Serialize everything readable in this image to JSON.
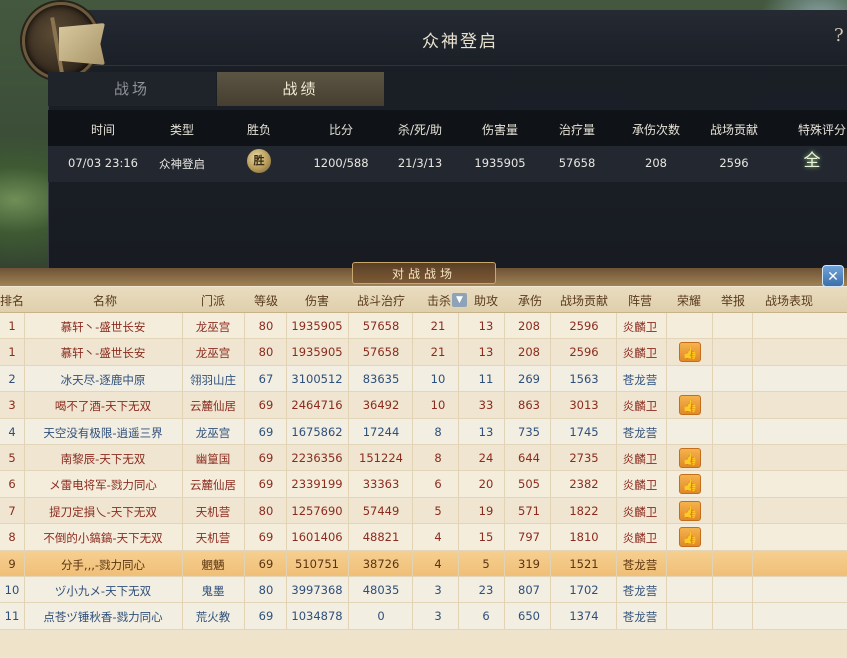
{
  "window": {
    "title": "众神登启",
    "help_symbol": "?"
  },
  "tabs": [
    {
      "label": "战场",
      "active": false
    },
    {
      "label": "战绩",
      "active": true
    }
  ],
  "record": {
    "headers": [
      "时间",
      "类型",
      "胜负",
      "比分",
      "杀/死/助",
      "伤害量",
      "治疗量",
      "承伤次数",
      "战场贡献",
      "特殊评分"
    ],
    "row": {
      "time": "07/03 23:16",
      "type": "众神登启",
      "result": "胜",
      "score": "1200/588",
      "kda": "21/3/13",
      "damage": "1935905",
      "healing": "57658",
      "hits_taken": "208",
      "contribution": "2596",
      "special": "全"
    }
  },
  "battle_panel": {
    "title": "对战战场",
    "close_symbol": "✕",
    "headers": [
      "排名",
      "名称",
      "门派",
      "等级",
      "伤害",
      "战斗治疗",
      "击杀",
      "助攻",
      "承伤",
      "战场贡献",
      "阵营",
      "荣耀",
      "举报",
      "战场表现"
    ],
    "sort_symbol": "▼",
    "like_symbol": "👍",
    "rows": [
      {
        "rank": "1",
        "name": "慕轩丶-盛世长安",
        "sect": "龙巫宫",
        "level": "80",
        "damage": "1935905",
        "healing": "57658",
        "kills": "21",
        "assists": "13",
        "taken": "208",
        "contribution": "2596",
        "camp": "炎麟卫",
        "team": "red",
        "like": false
      },
      {
        "rank": "1",
        "name": "慕轩丶-盛世长安",
        "sect": "龙巫宫",
        "level": "80",
        "damage": "1935905",
        "healing": "57658",
        "kills": "21",
        "assists": "13",
        "taken": "208",
        "contribution": "2596",
        "camp": "炎麟卫",
        "team": "red",
        "like": true
      },
      {
        "rank": "2",
        "name": "冰天尽-逐鹿中原",
        "sect": "翎羽山庄",
        "level": "67",
        "damage": "3100512",
        "healing": "83635",
        "kills": "10",
        "assists": "11",
        "taken": "269",
        "contribution": "1563",
        "camp": "苍龙营",
        "team": "blue",
        "like": false
      },
      {
        "rank": "3",
        "name": "喝不了酒-天下无双",
        "sect": "云麓仙居",
        "level": "69",
        "damage": "2464716",
        "healing": "36492",
        "kills": "10",
        "assists": "33",
        "taken": "863",
        "contribution": "3013",
        "camp": "炎麟卫",
        "team": "red",
        "like": true
      },
      {
        "rank": "4",
        "name": "天空没有极限-逍遥三界",
        "sect": "龙巫宫",
        "level": "69",
        "damage": "1675862",
        "healing": "17244",
        "kills": "8",
        "assists": "13",
        "taken": "735",
        "contribution": "1745",
        "camp": "苍龙营",
        "team": "blue",
        "like": false
      },
      {
        "rank": "5",
        "name": "南黎辰-天下无双",
        "sect": "幽篁国",
        "level": "69",
        "damage": "2236356",
        "healing": "151224",
        "kills": "8",
        "assists": "24",
        "taken": "644",
        "contribution": "2735",
        "camp": "炎麟卫",
        "team": "red",
        "like": true
      },
      {
        "rank": "6",
        "name": "メ雷电将军-戮力同心",
        "sect": "云麓仙居",
        "level": "69",
        "damage": "2339199",
        "healing": "33363",
        "kills": "6",
        "assists": "20",
        "taken": "505",
        "contribution": "2382",
        "camp": "炎麟卫",
        "team": "red",
        "like": true
      },
      {
        "rank": "7",
        "name": "提刀定損乀-天下无双",
        "sect": "天机营",
        "level": "80",
        "damage": "1257690",
        "healing": "57449",
        "kills": "5",
        "assists": "19",
        "taken": "571",
        "contribution": "1822",
        "camp": "炎麟卫",
        "team": "red",
        "like": true
      },
      {
        "rank": "8",
        "name": "不倒的小鎬鎬-天下无双",
        "sect": "天机营",
        "level": "69",
        "damage": "1601406",
        "healing": "48821",
        "kills": "4",
        "assists": "15",
        "taken": "797",
        "contribution": "1810",
        "camp": "炎麟卫",
        "team": "red",
        "like": true
      },
      {
        "rank": "9",
        "name": "分手,,,-戮力同心",
        "sect": "魍魉",
        "level": "69",
        "damage": "510751",
        "healing": "38726",
        "kills": "4",
        "assists": "5",
        "taken": "319",
        "contribution": "1521",
        "camp": "苍龙营",
        "team": "highlight",
        "like": false
      },
      {
        "rank": "10",
        "name": "ヅ小九メ-天下无双",
        "sect": "鬼墨",
        "level": "80",
        "damage": "3997368",
        "healing": "48035",
        "kills": "3",
        "assists": "23",
        "taken": "807",
        "contribution": "1702",
        "camp": "苍龙营",
        "team": "blue",
        "like": false
      },
      {
        "rank": "11",
        "name": "点苍ヅ锤秋香-戮力同心",
        "sect": "荒火教",
        "level": "69",
        "damage": "1034878",
        "healing": "0",
        "kills": "3",
        "assists": "6",
        "taken": "650",
        "contribution": "1374",
        "camp": "苍龙营",
        "team": "blue",
        "like": false
      }
    ]
  }
}
